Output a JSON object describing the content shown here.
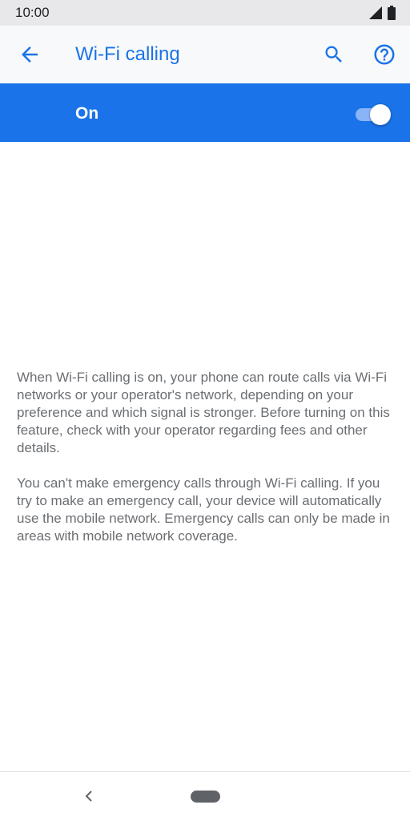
{
  "status_bar": {
    "time": "10:00",
    "icons": [
      "signal-icon",
      "battery-icon"
    ]
  },
  "app_bar": {
    "title": "Wi-Fi calling",
    "icons": [
      "back-arrow-icon",
      "search-icon",
      "help-icon"
    ]
  },
  "toggle": {
    "label": "On",
    "state": "on"
  },
  "description": {
    "paragraph_1": "When Wi-Fi calling is on, your phone can route calls via Wi-Fi networks or your operator's network, depending on your preference and which signal is stronger. Before turning on this feature, check with your operator regarding fees and other details.",
    "paragraph_2": "You can't make emergency calls through Wi-Fi calling. If you try to make an emergency call, your device will automatically use the mobile network. Emergency calls can only be made in areas with mobile network coverage."
  },
  "nav_bar": {
    "icons": [
      "nav-back-icon",
      "home-pill-icon"
    ]
  },
  "colors": {
    "accent": "#1a73e8",
    "status_bar_bg": "#e8e8ea",
    "app_bar_bg": "#f8f9fa",
    "body_text": "#6b6e72",
    "switch_track": "#8ab4f8"
  }
}
